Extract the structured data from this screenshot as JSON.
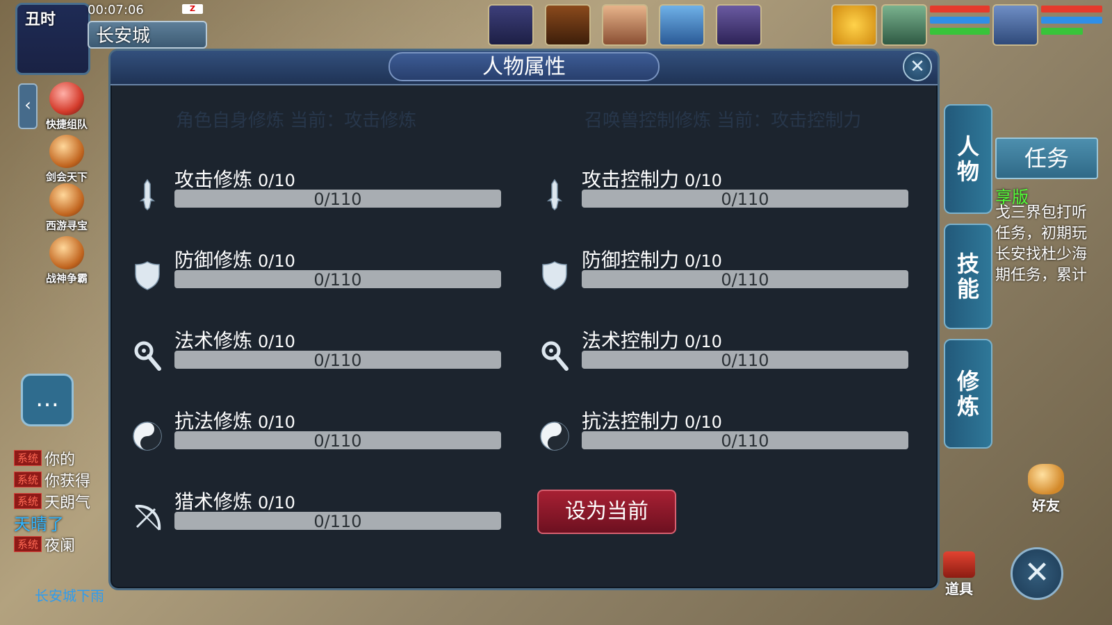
{
  "hud": {
    "time_label": "丑时",
    "clock": "00:07:06",
    "battery": "Z",
    "city": "长安城",
    "side_arrow": "‹"
  },
  "quick_actions": [
    {
      "label": "快捷组队"
    },
    {
      "label": "剑会天下"
    },
    {
      "label": "西游寻宝"
    },
    {
      "label": "战神争霸"
    }
  ],
  "chat": {
    "button_icon": "chat-bubble-icon",
    "lines": [
      {
        "tag": "系统",
        "text": "你的"
      },
      {
        "tag": "系统",
        "text": "你获得"
      },
      {
        "tag": "系统",
        "text": "天朗气"
      },
      {
        "tag": "",
        "text": "天晴了"
      },
      {
        "tag": "系统",
        "text": "夜阑"
      }
    ],
    "bottom_status": "长安城下雨"
  },
  "panel": {
    "title": "人物属性",
    "close": "✕",
    "left_section": "角色自身修炼  当前：攻击修炼",
    "right_section": "召唤兽控制修炼  当前：攻击控制力",
    "left_rows": [
      {
        "name": "攻击修炼",
        "level": "0/10",
        "value": "0/110",
        "progress": 0,
        "icon": "sword-icon"
      },
      {
        "name": "防御修炼",
        "level": "0/10",
        "value": "0/110",
        "progress": 0,
        "icon": "shield-icon"
      },
      {
        "name": "法术修炼",
        "level": "0/10",
        "value": "0/110",
        "progress": 0,
        "icon": "magic-staff-icon"
      },
      {
        "name": "抗法修炼",
        "level": "0/10",
        "value": "0/110",
        "progress": 0,
        "icon": "yin-yang-icon"
      },
      {
        "name": "猎术修炼",
        "level": "0/10",
        "value": "0/110",
        "progress": 0,
        "icon": "bow-icon"
      }
    ],
    "right_rows": [
      {
        "name": "攻击控制力",
        "level": "0/10",
        "value": "0/110",
        "progress": 0,
        "icon": "sword-icon"
      },
      {
        "name": "防御控制力",
        "level": "0/10",
        "value": "0/110",
        "progress": 0,
        "icon": "shield-icon"
      },
      {
        "name": "法术控制力",
        "level": "0/10",
        "value": "0/110",
        "progress": 0,
        "icon": "magic-staff-icon"
      },
      {
        "name": "抗法控制力",
        "level": "0/10",
        "value": "0/110",
        "progress": 0,
        "icon": "yin-yang-icon"
      }
    ],
    "set_current_button": "设为当前"
  },
  "side_tabs": [
    "人物",
    "技能",
    "修炼"
  ],
  "task": {
    "button": "任务",
    "green_text": "享版",
    "lines": [
      "戈三界包打听",
      "任务，初期玩",
      "长安找杜少海",
      "期任务，累计"
    ]
  },
  "friend_label": "好友",
  "item_label": "道具",
  "close_round": "✕",
  "colors": {
    "panel_bg": "#1c242e",
    "bar_track": "#a8adb2",
    "set_button": "#a72033",
    "task_green": "#53ff39",
    "chat_system": "#ff6a55"
  }
}
